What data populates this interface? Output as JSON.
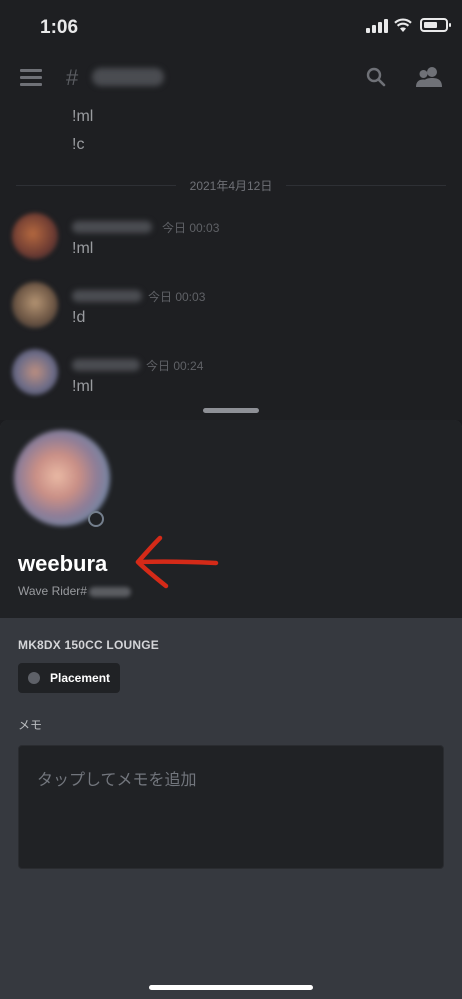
{
  "status_bar": {
    "time": "1:06"
  },
  "chat": {
    "top_messages": [
      "!ml",
      "!c"
    ],
    "date_divider": "2021年4月12日",
    "messages": [
      {
        "timestamp": "今日 00:03",
        "text": "!ml"
      },
      {
        "timestamp": "今日 00:03",
        "text": "!d"
      },
      {
        "timestamp": "今日 00:24",
        "text": "!ml"
      }
    ]
  },
  "profile": {
    "username": "weebura",
    "tag_prefix": "Wave Rider#",
    "server_name": "MK8DX 150CC LOUNGE",
    "role": {
      "label": "Placement",
      "color": "#5e6168"
    },
    "memo_title": "メモ",
    "memo_placeholder": "タップしてメモを追加"
  },
  "colors": {
    "annotation_arrow": "#d42a18",
    "sheet_bg": "#36393f",
    "banner_bg": "#202225"
  },
  "icons": [
    "hamburger-icon",
    "hash-lock-icon",
    "search-icon",
    "members-icon",
    "signal-icon",
    "wifi-icon",
    "battery-icon"
  ]
}
